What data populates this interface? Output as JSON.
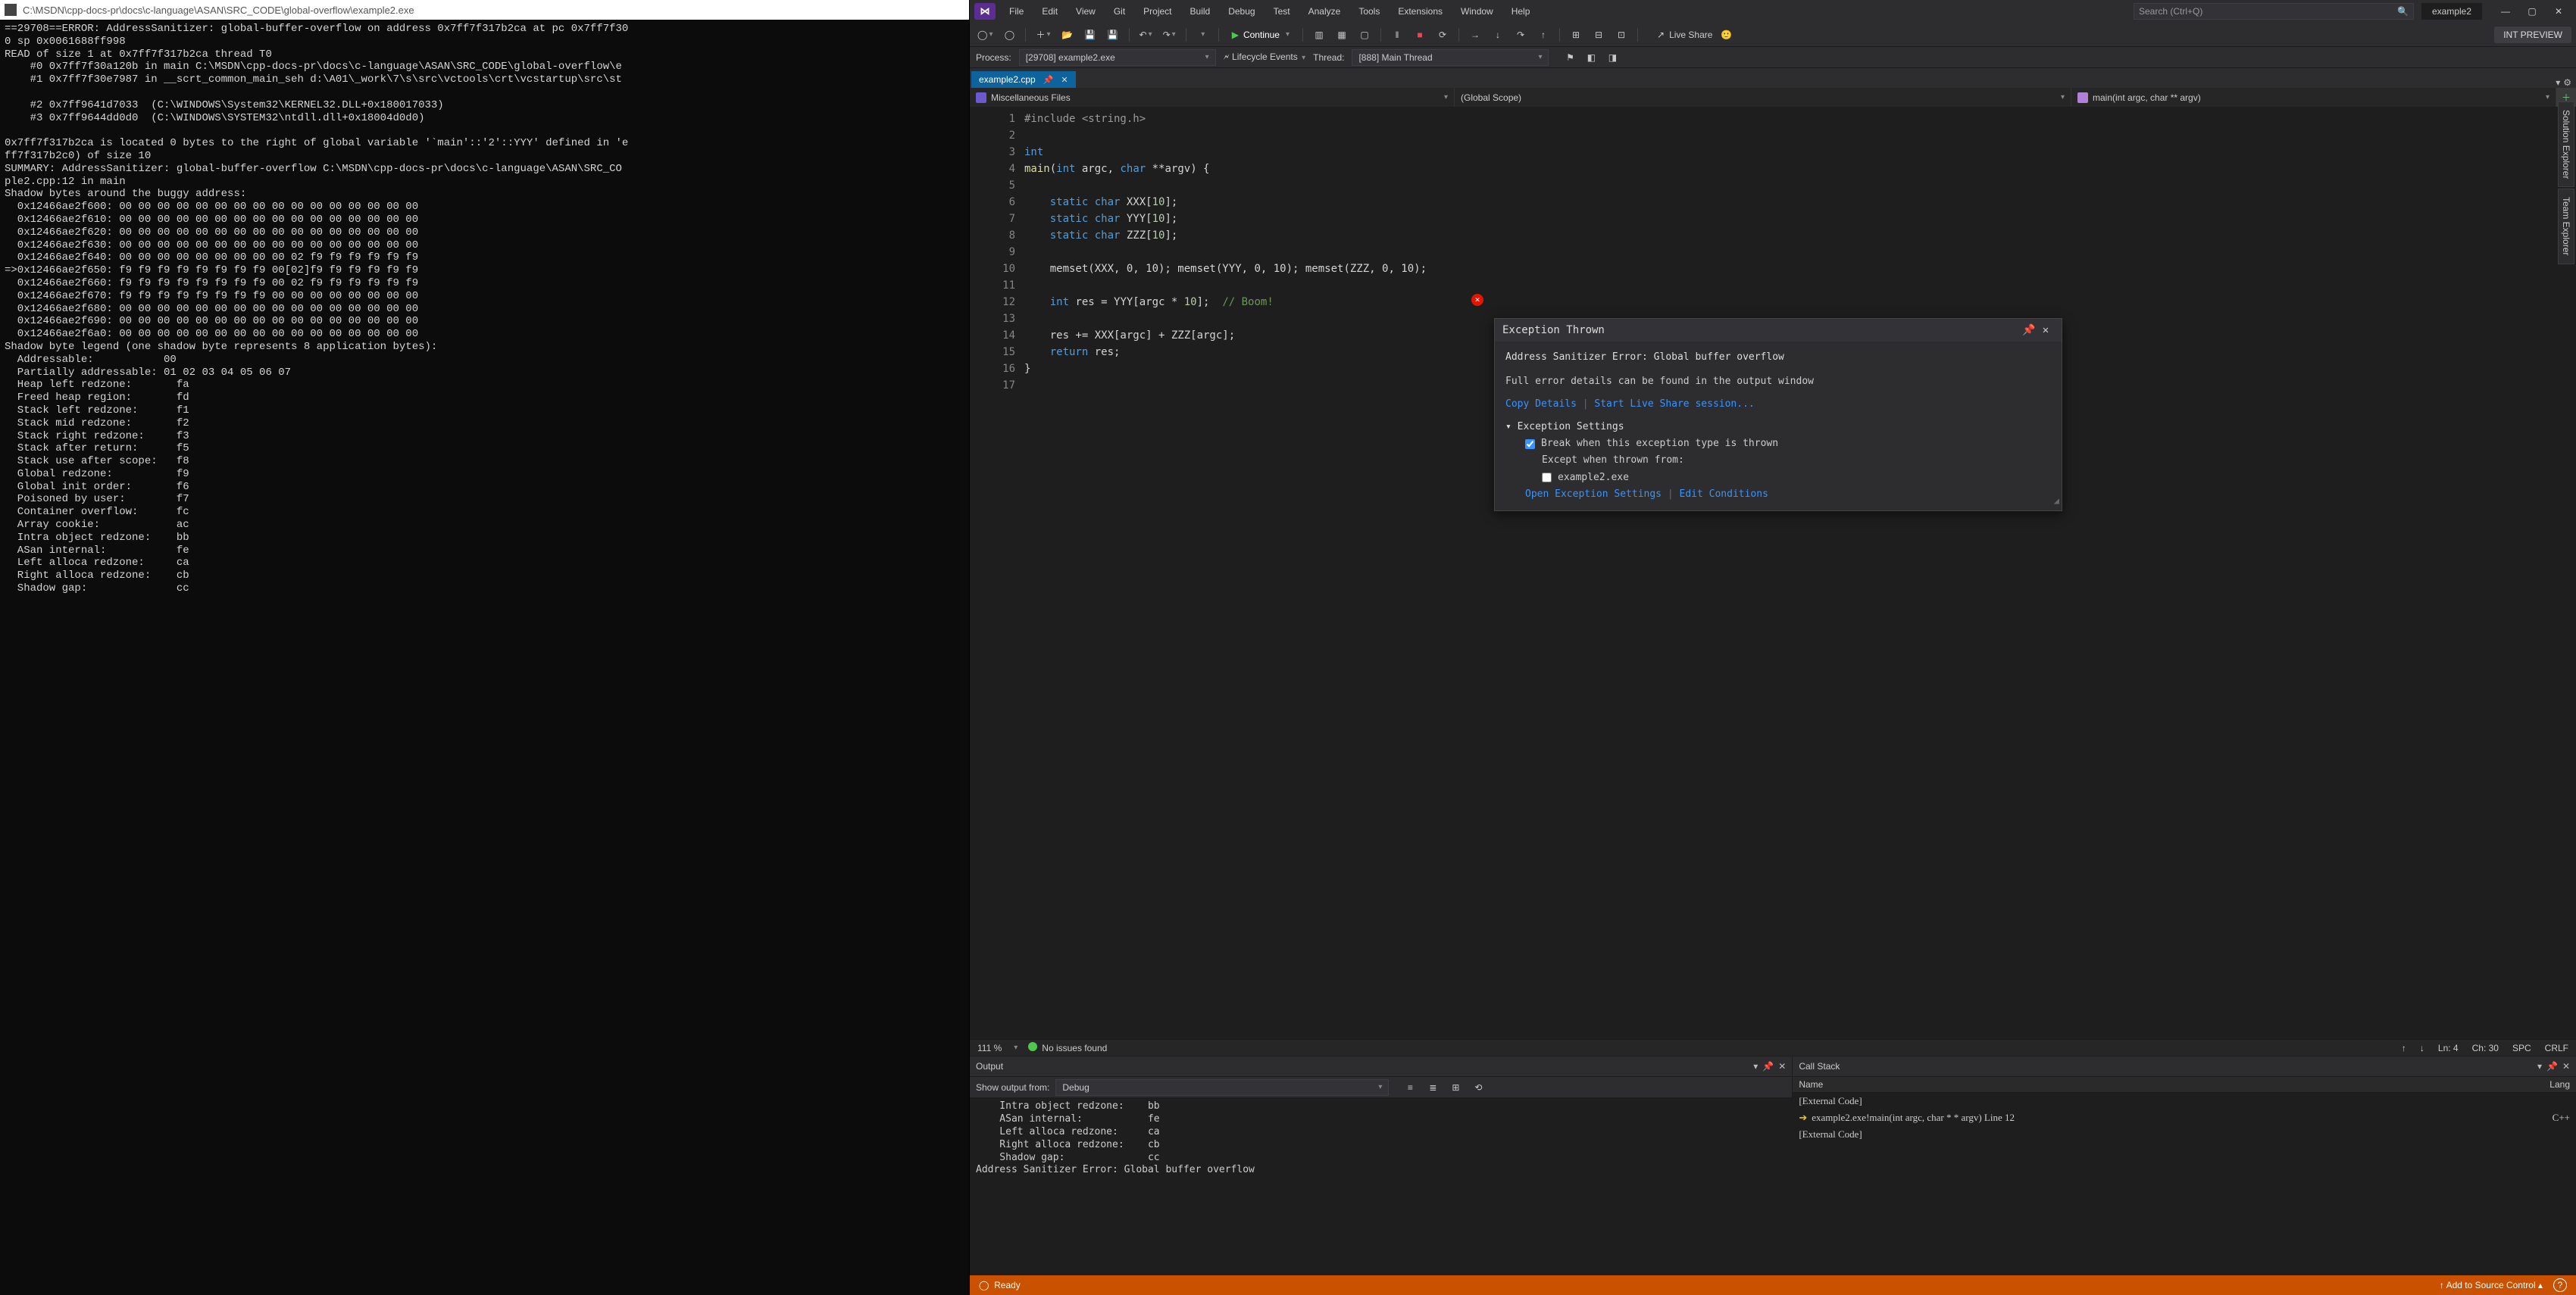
{
  "console": {
    "title": "C:\\MSDN\\cpp-docs-pr\\docs\\c-language\\ASAN\\SRC_CODE\\global-overflow\\example2.exe",
    "body": "==29708==ERROR: AddressSanitizer: global-buffer-overflow on address 0x7ff7f317b2ca at pc 0x7ff7f30\n0 sp 0x0061688ff998\nREAD of size 1 at 0x7ff7f317b2ca thread T0\n    #0 0x7ff7f30a120b in main C:\\MSDN\\cpp-docs-pr\\docs\\c-language\\ASAN\\SRC_CODE\\global-overflow\\e\n    #1 0x7ff7f30e7987 in __scrt_common_main_seh d:\\A01\\_work\\7\\s\\src\\vctools\\crt\\vcstartup\\src\\st\n\n    #2 0x7ff9641d7033  (C:\\WINDOWS\\System32\\KERNEL32.DLL+0x180017033)\n    #3 0x7ff9644dd0d0  (C:\\WINDOWS\\SYSTEM32\\ntdll.dll+0x18004d0d0)\n\n0x7ff7f317b2ca is located 0 bytes to the right of global variable '`main'::'2'::YYY' defined in 'e\nff7f317b2c0) of size 10\nSUMMARY: AddressSanitizer: global-buffer-overflow C:\\MSDN\\cpp-docs-pr\\docs\\c-language\\ASAN\\SRC_CO\nple2.cpp:12 in main\nShadow bytes around the buggy address:\n  0x12466ae2f600: 00 00 00 00 00 00 00 00 00 00 00 00 00 00 00 00\n  0x12466ae2f610: 00 00 00 00 00 00 00 00 00 00 00 00 00 00 00 00\n  0x12466ae2f620: 00 00 00 00 00 00 00 00 00 00 00 00 00 00 00 00\n  0x12466ae2f630: 00 00 00 00 00 00 00 00 00 00 00 00 00 00 00 00\n  0x12466ae2f640: 00 00 00 00 00 00 00 00 00 02 f9 f9 f9 f9 f9 f9\n=>0x12466ae2f650: f9 f9 f9 f9 f9 f9 f9 f9 00[02]f9 f9 f9 f9 f9 f9\n  0x12466ae2f660: f9 f9 f9 f9 f9 f9 f9 f9 00 02 f9 f9 f9 f9 f9 f9\n  0x12466ae2f670: f9 f9 f9 f9 f9 f9 f9 f9 00 00 00 00 00 00 00 00\n  0x12466ae2f680: 00 00 00 00 00 00 00 00 00 00 00 00 00 00 00 00\n  0x12466ae2f690: 00 00 00 00 00 00 00 00 00 00 00 00 00 00 00 00\n  0x12466ae2f6a0: 00 00 00 00 00 00 00 00 00 00 00 00 00 00 00 00\nShadow byte legend (one shadow byte represents 8 application bytes):\n  Addressable:           00\n  Partially addressable: 01 02 03 04 05 06 07\n  Heap left redzone:       fa\n  Freed heap region:       fd\n  Stack left redzone:      f1\n  Stack mid redzone:       f2\n  Stack right redzone:     f3\n  Stack after return:      f5\n  Stack use after scope:   f8\n  Global redzone:          f9\n  Global init order:       f6\n  Poisoned by user:        f7\n  Container overflow:      fc\n  Array cookie:            ac\n  Intra object redzone:    bb\n  ASan internal:           fe\n  Left alloca redzone:     ca\n  Right alloca redzone:    cb\n  Shadow gap:              cc"
  },
  "menu": [
    "File",
    "Edit",
    "View",
    "Git",
    "Project",
    "Build",
    "Debug",
    "Test",
    "Analyze",
    "Tools",
    "Extensions",
    "Window",
    "Help"
  ],
  "search_placeholder": "Search (Ctrl+Q)",
  "solution_tab": "example2",
  "toolbar": {
    "continue": "Continue",
    "liveshare": "Live Share",
    "preview": "INT PREVIEW"
  },
  "debugbar": {
    "process_lbl": "Process:",
    "process_val": "[29708] example2.exe",
    "lifecycle": "Lifecycle Events",
    "thread_lbl": "Thread:",
    "thread_val": "[888] Main Thread"
  },
  "filetab": "example2.cpp",
  "nav": {
    "a": "Miscellaneous Files",
    "b": "(Global Scope)",
    "c": "main(int argc, char ** argv)"
  },
  "code_lines": {
    "l1": "#include <string.h>",
    "l3a": "int",
    "l4a": "main",
    "l4b": "int",
    "l4c": " argc, ",
    "l4d": "char",
    "l4e": " **argv) {",
    "l6a": "static char",
    "l6b": " XXX[",
    "l6c": "10",
    "l6d": "];",
    "l7a": "static char",
    "l7b": " YYY[",
    "l7c": "10",
    "l7d": "];",
    "l8a": "static char",
    "l8b": " ZZZ[",
    "l8c": "10",
    "l8d": "];",
    "l10": "memset(XXX, 0, 10); memset(YYY, 0, 10); memset(ZZZ, 0, 10);",
    "l12a": "int",
    "l12b": " res = YYY[argc * ",
    "l12c": "10",
    "l12d": "];  ",
    "l12e": "// Boom!",
    "l14": "res += XXX[argc] + ZZZ[argc];",
    "l15a": "return",
    "l15b": " res;",
    "l16": "}"
  },
  "editor_status": {
    "zoom": "111 %",
    "issues": "No issues found",
    "ln": "Ln: 4",
    "ch": "Ch: 30",
    "spc": "SPC",
    "crlf": "CRLF"
  },
  "output": {
    "title": "Output",
    "from_lbl": "Show output from:",
    "from_val": "Debug",
    "body": "    Intra object redzone:    bb\n    ASan internal:           fe\n    Left alloca redzone:     ca\n    Right alloca redzone:    cb\n    Shadow gap:              cc\nAddress Sanitizer Error: Global buffer overflow"
  },
  "callstack": {
    "title": "Call Stack",
    "col_name": "Name",
    "col_lang": "Lang",
    "rows": [
      {
        "name": "[External Code]",
        "lang": ""
      },
      {
        "name": "example2.exe!main(int argc, char * * argv) Line 12",
        "lang": "C++",
        "current": true
      },
      {
        "name": "[External Code]",
        "lang": ""
      }
    ]
  },
  "exception": {
    "title": "Exception Thrown",
    "msg": "Address Sanitizer Error: Global buffer overflow",
    "detail": "Full error details can be found in the output window",
    "copy": "Copy Details",
    "startls": "Start Live Share session...",
    "settings_hdr": "Exception Settings",
    "break_lbl": "Break when this exception type is thrown",
    "except_lbl": "Except when thrown from:",
    "except_item": "example2.exe",
    "open": "Open Exception Settings",
    "edit": "Edit Conditions"
  },
  "status": {
    "ready": "Ready",
    "srcctl": "Add to Source Control"
  },
  "sidepins": [
    "Solution Explorer",
    "Team Explorer"
  ]
}
